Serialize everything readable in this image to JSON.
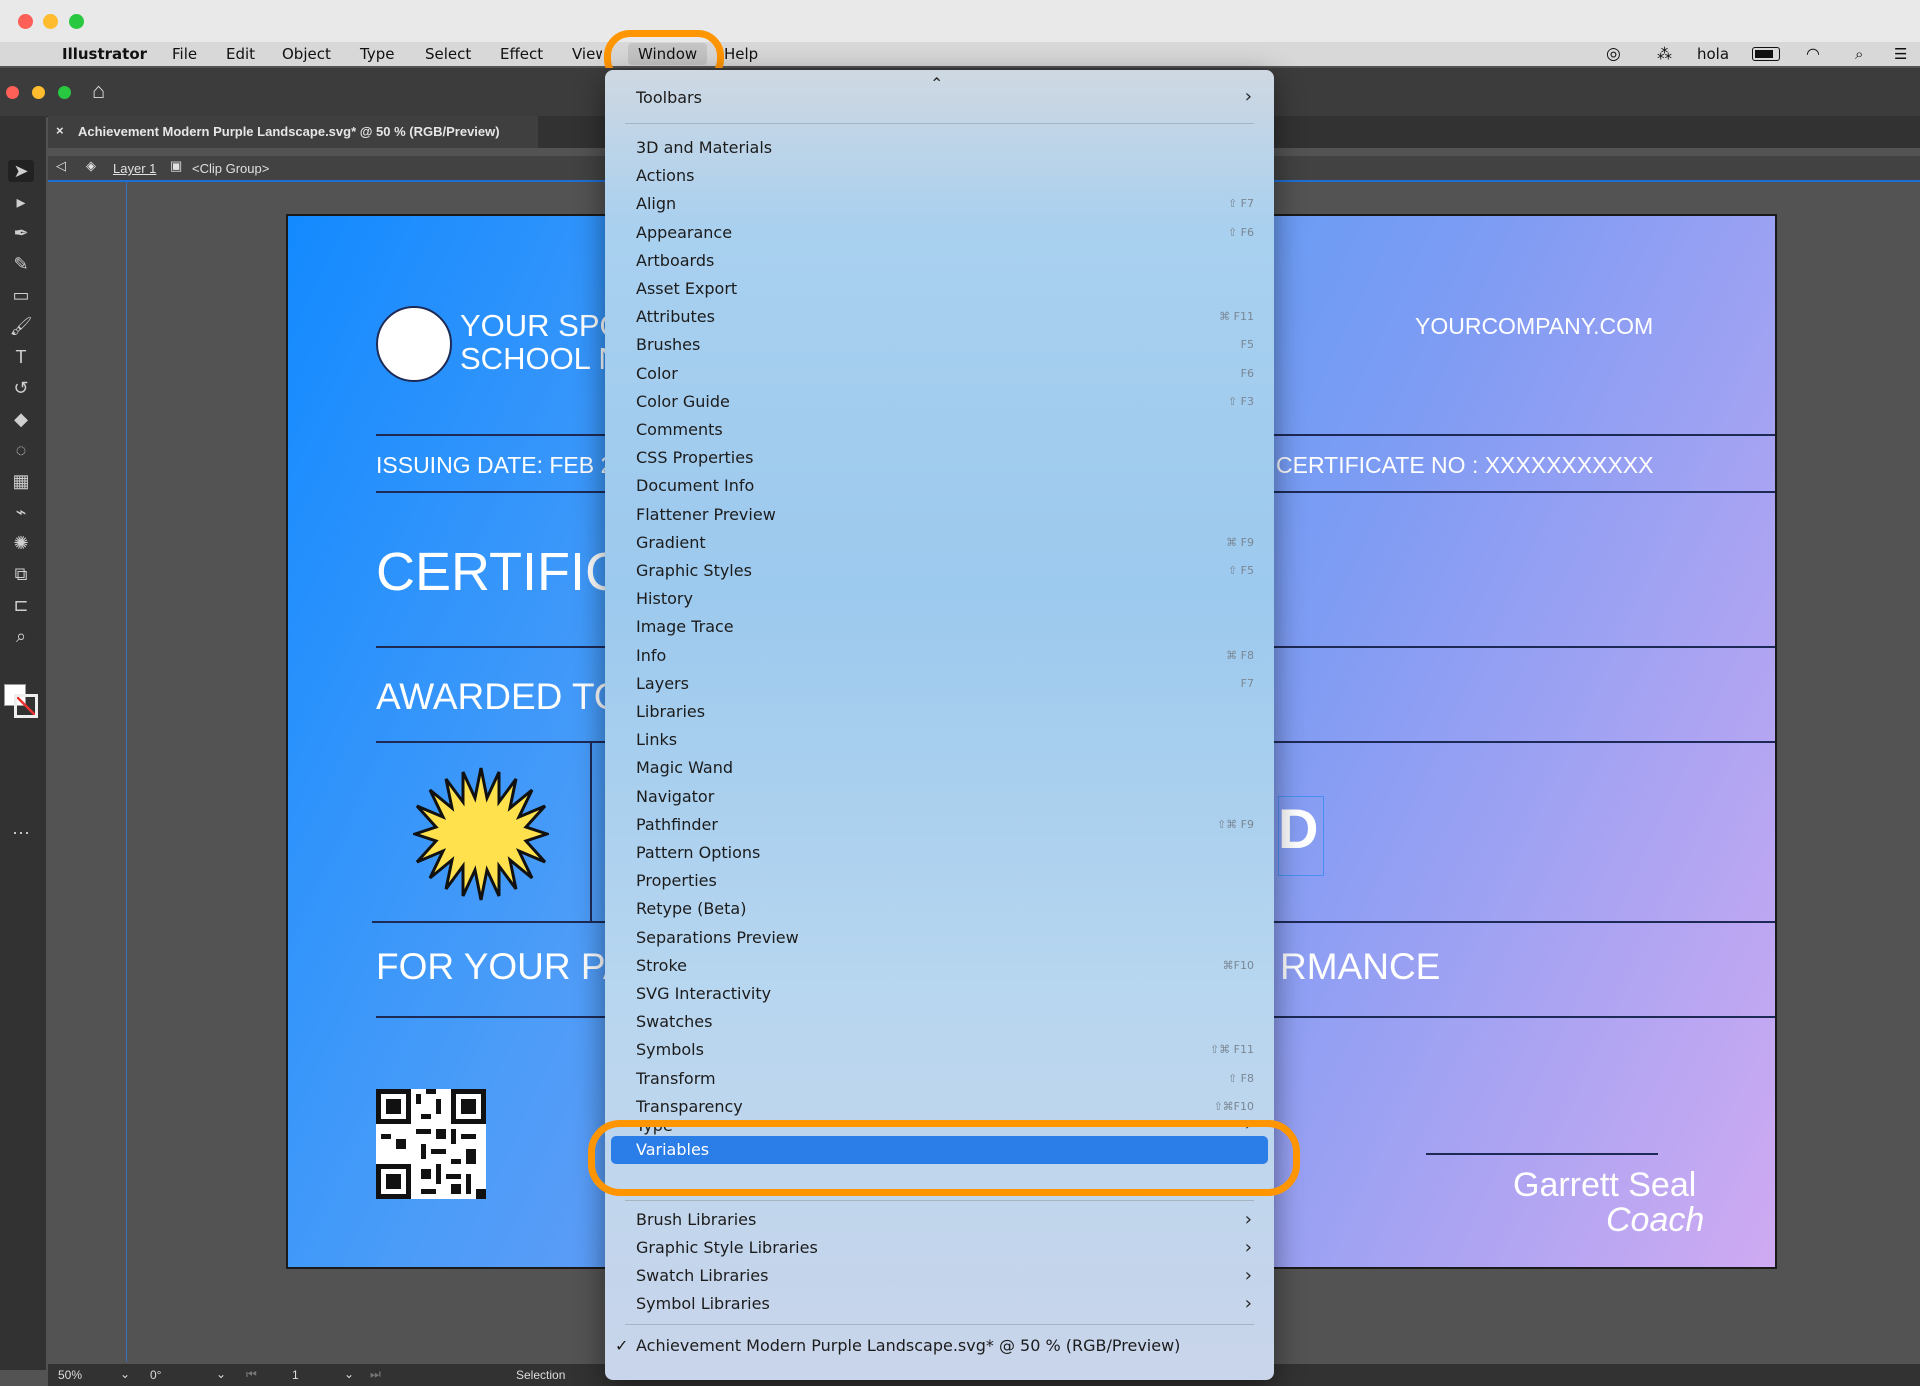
{
  "menubar": {
    "app_name": "Illustrator",
    "items": [
      "File",
      "Edit",
      "Object",
      "Type",
      "Select",
      "Effect",
      "View",
      "Window",
      "Help"
    ],
    "right": {
      "user": "hola"
    }
  },
  "document": {
    "tab_title": "Achievement Modern Purple Landscape.svg* @ 50 % (RGB/Preview)",
    "layer": "Layer 1",
    "clip_group": "<Clip Group>"
  },
  "artboard": {
    "sponsor_line1": "YOUR SPO",
    "sponsor_line2": "SCHOOL N",
    "website": "YOURCOMPANY.COM",
    "issuing_date": "ISSUING DATE: FEB 2",
    "certificate_no": "CERTIFICATE NO : XXXXXXXXXXX",
    "certificate_title": "CERTIFIC",
    "awarded_to": "AWARDED TO",
    "name_fragment": "D",
    "for_your": "FOR YOUR PA",
    "performance": "RMANCE",
    "signer_name": "Garrett Seal",
    "signer_role": "Coach"
  },
  "window_menu": {
    "top_item": {
      "label": "Toolbars"
    },
    "items": [
      {
        "label": "3D and Materials",
        "shortcut": ""
      },
      {
        "label": "Actions",
        "shortcut": ""
      },
      {
        "label": "Align",
        "shortcut": "⇧ F7"
      },
      {
        "label": "Appearance",
        "shortcut": "⇧ F6"
      },
      {
        "label": "Artboards",
        "shortcut": ""
      },
      {
        "label": "Asset Export",
        "shortcut": ""
      },
      {
        "label": "Attributes",
        "shortcut": "⌘ F11"
      },
      {
        "label": "Brushes",
        "shortcut": "F5"
      },
      {
        "label": "Color",
        "shortcut": "F6"
      },
      {
        "label": "Color Guide",
        "shortcut": "⇧ F3"
      },
      {
        "label": "Comments",
        "shortcut": ""
      },
      {
        "label": "CSS Properties",
        "shortcut": ""
      },
      {
        "label": "Document Info",
        "shortcut": ""
      },
      {
        "label": "Flattener Preview",
        "shortcut": ""
      },
      {
        "label": "Gradient",
        "shortcut": "⌘ F9"
      },
      {
        "label": "Graphic Styles",
        "shortcut": "⇧ F5"
      },
      {
        "label": "History",
        "shortcut": ""
      },
      {
        "label": "Image Trace",
        "shortcut": ""
      },
      {
        "label": "Info",
        "shortcut": "⌘ F8"
      },
      {
        "label": "Layers",
        "shortcut": "F7"
      },
      {
        "label": "Libraries",
        "shortcut": ""
      },
      {
        "label": "Links",
        "shortcut": ""
      },
      {
        "label": "Magic Wand",
        "shortcut": ""
      },
      {
        "label": "Navigator",
        "shortcut": ""
      },
      {
        "label": "Pathfinder",
        "shortcut": "⇧⌘ F9"
      },
      {
        "label": "Pattern Options",
        "shortcut": ""
      },
      {
        "label": "Properties",
        "shortcut": ""
      },
      {
        "label": "Retype (Beta)",
        "shortcut": ""
      },
      {
        "label": "Separations Preview",
        "shortcut": ""
      },
      {
        "label": "Stroke",
        "shortcut": "⌘F10"
      },
      {
        "label": "SVG Interactivity",
        "shortcut": ""
      },
      {
        "label": "Swatches",
        "shortcut": ""
      },
      {
        "label": "Symbols",
        "shortcut": "⇧⌘ F11"
      },
      {
        "label": "Transform",
        "shortcut": "⇧ F8"
      },
      {
        "label": "Transparency",
        "shortcut": "⇧⌘F10"
      }
    ],
    "type_item": "Type",
    "variables_item": "Variables",
    "library_items": [
      "Brush Libraries",
      "Graphic Style Libraries",
      "Swatch Libraries",
      "Symbol Libraries"
    ],
    "open_document": "Achievement Modern Purple Landscape.svg* @ 50 % (RGB/Preview)"
  },
  "statusbar": {
    "zoom": "50%",
    "rotation": "0°",
    "artboard_num": "1",
    "tool": "Selection"
  },
  "colors": {
    "accent": "#2b7de8",
    "highlight_ring": "#ff9500"
  }
}
